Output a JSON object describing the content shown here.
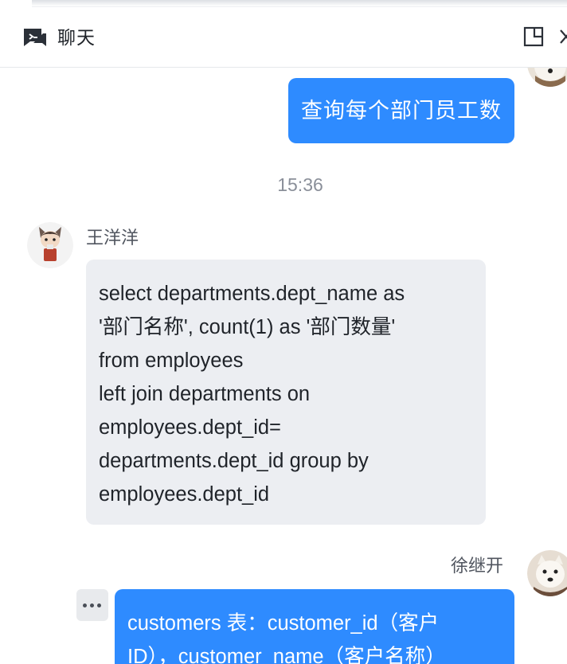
{
  "header": {
    "title": "聊天"
  },
  "messages": [
    {
      "role": "user",
      "text": "查询每个部门员工数"
    },
    {
      "role": "time",
      "text": "15:36"
    },
    {
      "role": "bot",
      "sender": "王洋洋",
      "text": "select departments.dept_name as\n'部门名称', count(1) as '部门数量'\nfrom employees\nleft join departments on\nemployees.dept_id=\ndepartments.dept_id group by\nemployees.dept_id"
    },
    {
      "role": "user",
      "sender": "徐继开",
      "text": "customers 表：customer_id（客户\nID），customer_name（客户名称）"
    }
  ],
  "colors": {
    "user_bubble": "#2e8bff",
    "bot_bubble": "#eceef2"
  },
  "icons": [
    "chat-icon",
    "expand-icon",
    "close-icon",
    "more-icon"
  ]
}
